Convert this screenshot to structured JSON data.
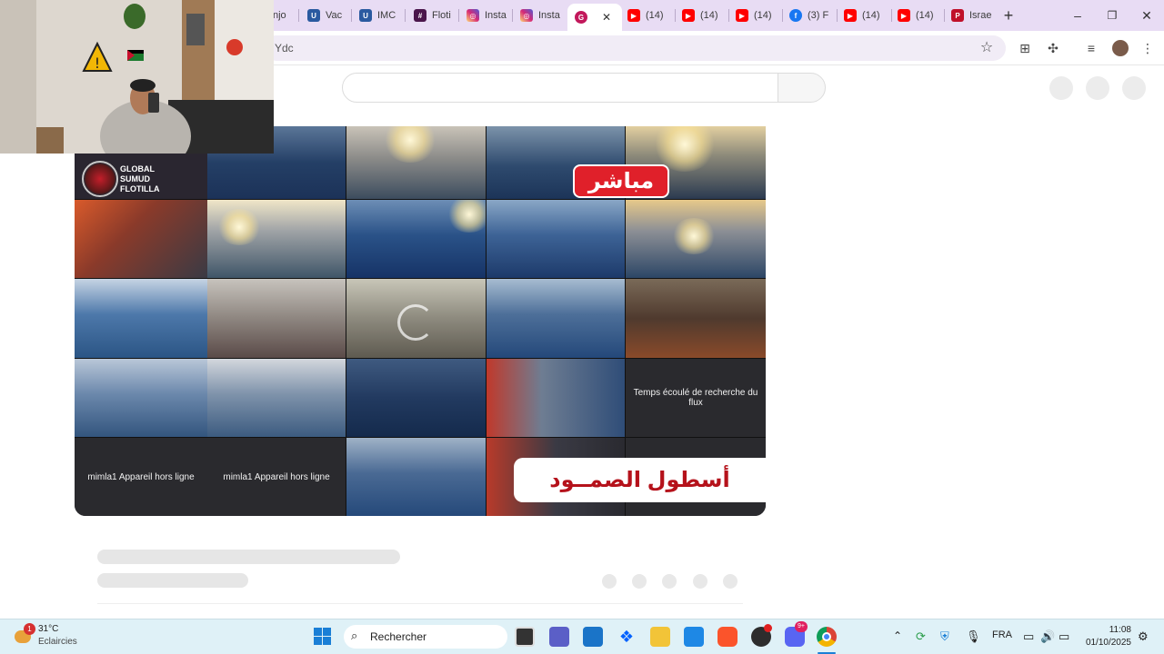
{
  "browser": {
    "tabs": [
      {
        "label": "njo",
        "favicon": "generic",
        "color": "#3a79c8"
      },
      {
        "label": "Vac",
        "favicon": "uni",
        "color": "#2a5aa0"
      },
      {
        "label": "IMC",
        "favicon": "uni",
        "color": "#2a5aa0"
      },
      {
        "label": "Floti",
        "favicon": "slack",
        "color": "#4a154b"
      },
      {
        "label": "Insta",
        "favicon": "instagram",
        "color": "#d62976"
      },
      {
        "label": "Insta",
        "favicon": "instagram",
        "color": "#d62976"
      },
      {
        "label": "",
        "favicon": "active-site",
        "color": "#c2185b"
      },
      {
        "label": "(14)",
        "favicon": "youtube",
        "color": "#ff0000"
      },
      {
        "label": "(14)",
        "favicon": "youtube",
        "color": "#ff0000"
      },
      {
        "label": "(14)",
        "favicon": "youtube",
        "color": "#ff0000"
      },
      {
        "label": "(3) F",
        "favicon": "facebook",
        "color": "#1877f2"
      },
      {
        "label": "(14)",
        "favicon": "youtube",
        "color": "#ff0000"
      },
      {
        "label": "(14)",
        "favicon": "youtube",
        "color": "#ff0000"
      },
      {
        "label": "Israe",
        "favicon": "p-icon",
        "color": "#c0102a"
      }
    ],
    "new_tab": "+",
    "window_controls": {
      "minimize": "–",
      "maximize": "❐",
      "close": "✕"
    },
    "tab_close": "✕",
    "url": "Ydc"
  },
  "video": {
    "live_badge": "مباشر",
    "fleet_banner": "أسطول الصمــود",
    "logo_text": [
      "GLOBAL",
      "SUMUD",
      "FLOTILLA"
    ],
    "cell_messages": {
      "timeout": "Temps écoulé de recherche du flux",
      "offline_1": "mimla1 Appareil hors ligne",
      "offline_2": "mimla1 Appareil hors ligne"
    }
  },
  "taskbar": {
    "weather_temp": "31°C",
    "weather_desc": "Eclaircies",
    "weather_badge": "1",
    "search_label": "Rechercher",
    "language": "FRA",
    "time": "11:08",
    "date": "01/10/2025",
    "discord_badge": "9+"
  }
}
